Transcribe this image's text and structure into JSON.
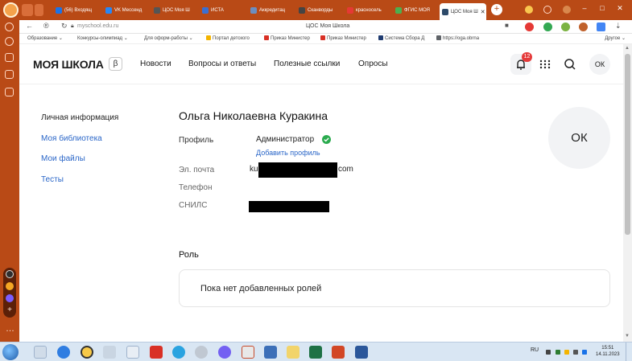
{
  "browser": {
    "tabs": [
      {
        "label": "(56) Входящ",
        "favicon_color": "#1a73e8"
      },
      {
        "label": "VK Мессенд",
        "favicon_color": "#2787f5"
      },
      {
        "label": "ЦОС Моя Ш",
        "favicon_color": "#555555"
      },
      {
        "label": "ИСТА",
        "favicon_color": "#3b6fd1"
      },
      {
        "label": "Аккредитац",
        "favicon_color": "#6c8ebf"
      },
      {
        "label": "Сканворды",
        "favicon_color": "#444444"
      },
      {
        "label": "красносель",
        "favicon_color": "#e53935"
      },
      {
        "label": "ФГИС МОЯ",
        "favicon_color": "#4caf50"
      },
      {
        "label": "ЦОС Моя Ш",
        "favicon_color": "#2d4a6a",
        "active": true
      }
    ],
    "new_tab": "+",
    "window_controls": {
      "minimize": "–",
      "maximize": "□",
      "close": "✕"
    },
    "address": {
      "url": "myschool.edu.ru",
      "page_title": "ЦОС Моя Школа"
    },
    "bookmarks": [
      {
        "label": "Образование",
        "color": "#ffffff",
        "chevron": true
      },
      {
        "label": "Конкурсы-олимпиад",
        "color": "#ffffff",
        "chevron": true
      },
      {
        "label": "Для оформ-работы",
        "color": "#ffffff",
        "chevron": true
      },
      {
        "label": "Портал детского",
        "color": "#f4b400"
      },
      {
        "label": "Приказ Министер",
        "color": "#d93025"
      },
      {
        "label": "Приказ Министер",
        "color": "#d93025"
      },
      {
        "label": "Система Сбора Д",
        "color": "#1f3b70"
      },
      {
        "label": "https://oga.obrna",
        "color": "#5f6368"
      }
    ],
    "bookmarks_other": "Другое"
  },
  "site": {
    "logo": "МОЯ ШКОЛА",
    "beta": "β",
    "nav": [
      "Новости",
      "Вопросы и ответы",
      "Полезные ссылки",
      "Опросы"
    ],
    "notifications_count": "12",
    "avatar_initials": "ОК"
  },
  "sidebar_menu": [
    {
      "label": "Личная информация",
      "active": true
    },
    {
      "label": "Моя библиотека"
    },
    {
      "label": "Мои файлы"
    },
    {
      "label": "Тесты"
    }
  ],
  "profile": {
    "name": "Ольга Николаевна Куракина",
    "profile_label": "Профиль",
    "role": "Администратор",
    "add_profile": "Добавить профиль",
    "email_label": "Эл. почта",
    "email_prefix": "ku",
    "email_suffix": "com",
    "phone_label": "Телефон",
    "snils_label": "СНИЛС",
    "avatar_initials": "ОК"
  },
  "roles": {
    "title": "Роль",
    "empty_text": "Пока нет добавленных ролей"
  },
  "taskbar": {
    "lang": "RU",
    "time": "15:51",
    "date": "14.11.2023"
  }
}
